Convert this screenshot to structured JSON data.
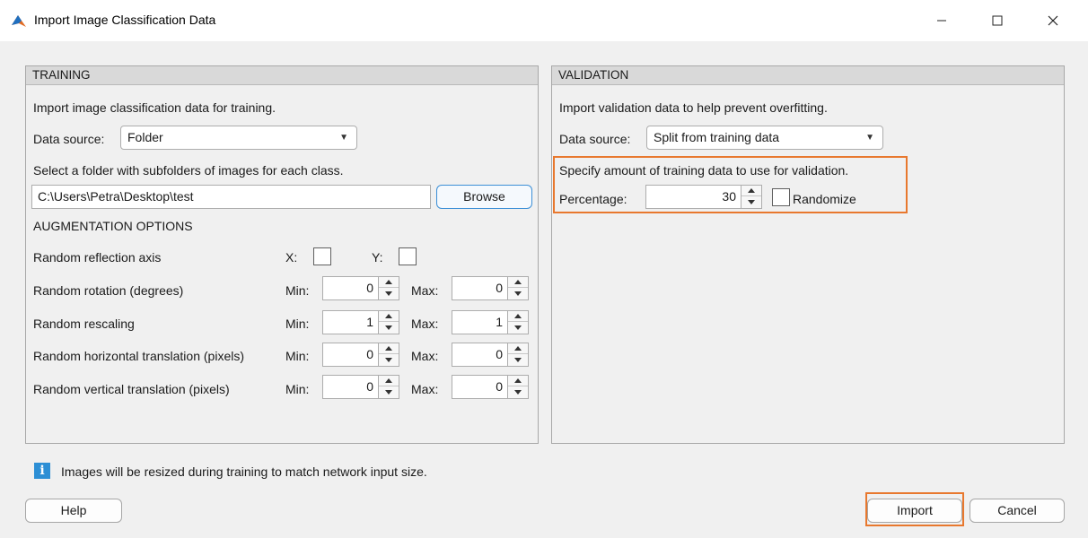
{
  "window": {
    "title": "Import Image Classification Data",
    "app_icon": "matlab-logo-icon",
    "controls": [
      "minimize-icon",
      "maximize-icon",
      "close-icon"
    ]
  },
  "training": {
    "header": "TRAINING",
    "intro": "Import image classification data for training.",
    "data_source_label": "Data source:",
    "data_source_value": "Folder",
    "folder_instruction": "Select a folder with subfolders of images for each class.",
    "folder_path": "C:\\Users\\Petra\\Desktop\\test",
    "browse_label": "Browse",
    "augmentation_header": "AUGMENTATION OPTIONS",
    "reflection": {
      "label": "Random reflection axis",
      "x_label": "X:",
      "y_label": "Y:",
      "x_checked": false,
      "y_checked": false
    },
    "rows": [
      {
        "label": "Random rotation (degrees)",
        "min_label": "Min:",
        "min": "0",
        "max_label": "Max:",
        "max": "0"
      },
      {
        "label": "Random rescaling",
        "min_label": "Min:",
        "min": "1",
        "max_label": "Max:",
        "max": "1"
      },
      {
        "label": "Random horizontal translation (pixels)",
        "min_label": "Min:",
        "min": "0",
        "max_label": "Max:",
        "max": "0"
      },
      {
        "label": "Random vertical translation (pixels)",
        "min_label": "Min:",
        "min": "0",
        "max_label": "Max:",
        "max": "0"
      }
    ]
  },
  "validation": {
    "header": "VALIDATION",
    "intro": "Import validation data to help prevent overfitting.",
    "data_source_label": "Data source:",
    "data_source_value": "Split from training data",
    "specify_text": "Specify amount of training data to use for validation.",
    "percentage_label": "Percentage:",
    "percentage_value": "30",
    "randomize_label": "Randomize",
    "randomize_checked": false
  },
  "info_message": "Images will be resized during training to match network input size.",
  "buttons": {
    "help": "Help",
    "import": "Import",
    "cancel": "Cancel"
  },
  "colors": {
    "highlight": "#e8782e",
    "info_icon": "#2d8fd5",
    "panel_header": "#d9d9d9",
    "browse_border": "#3c8fd6"
  }
}
